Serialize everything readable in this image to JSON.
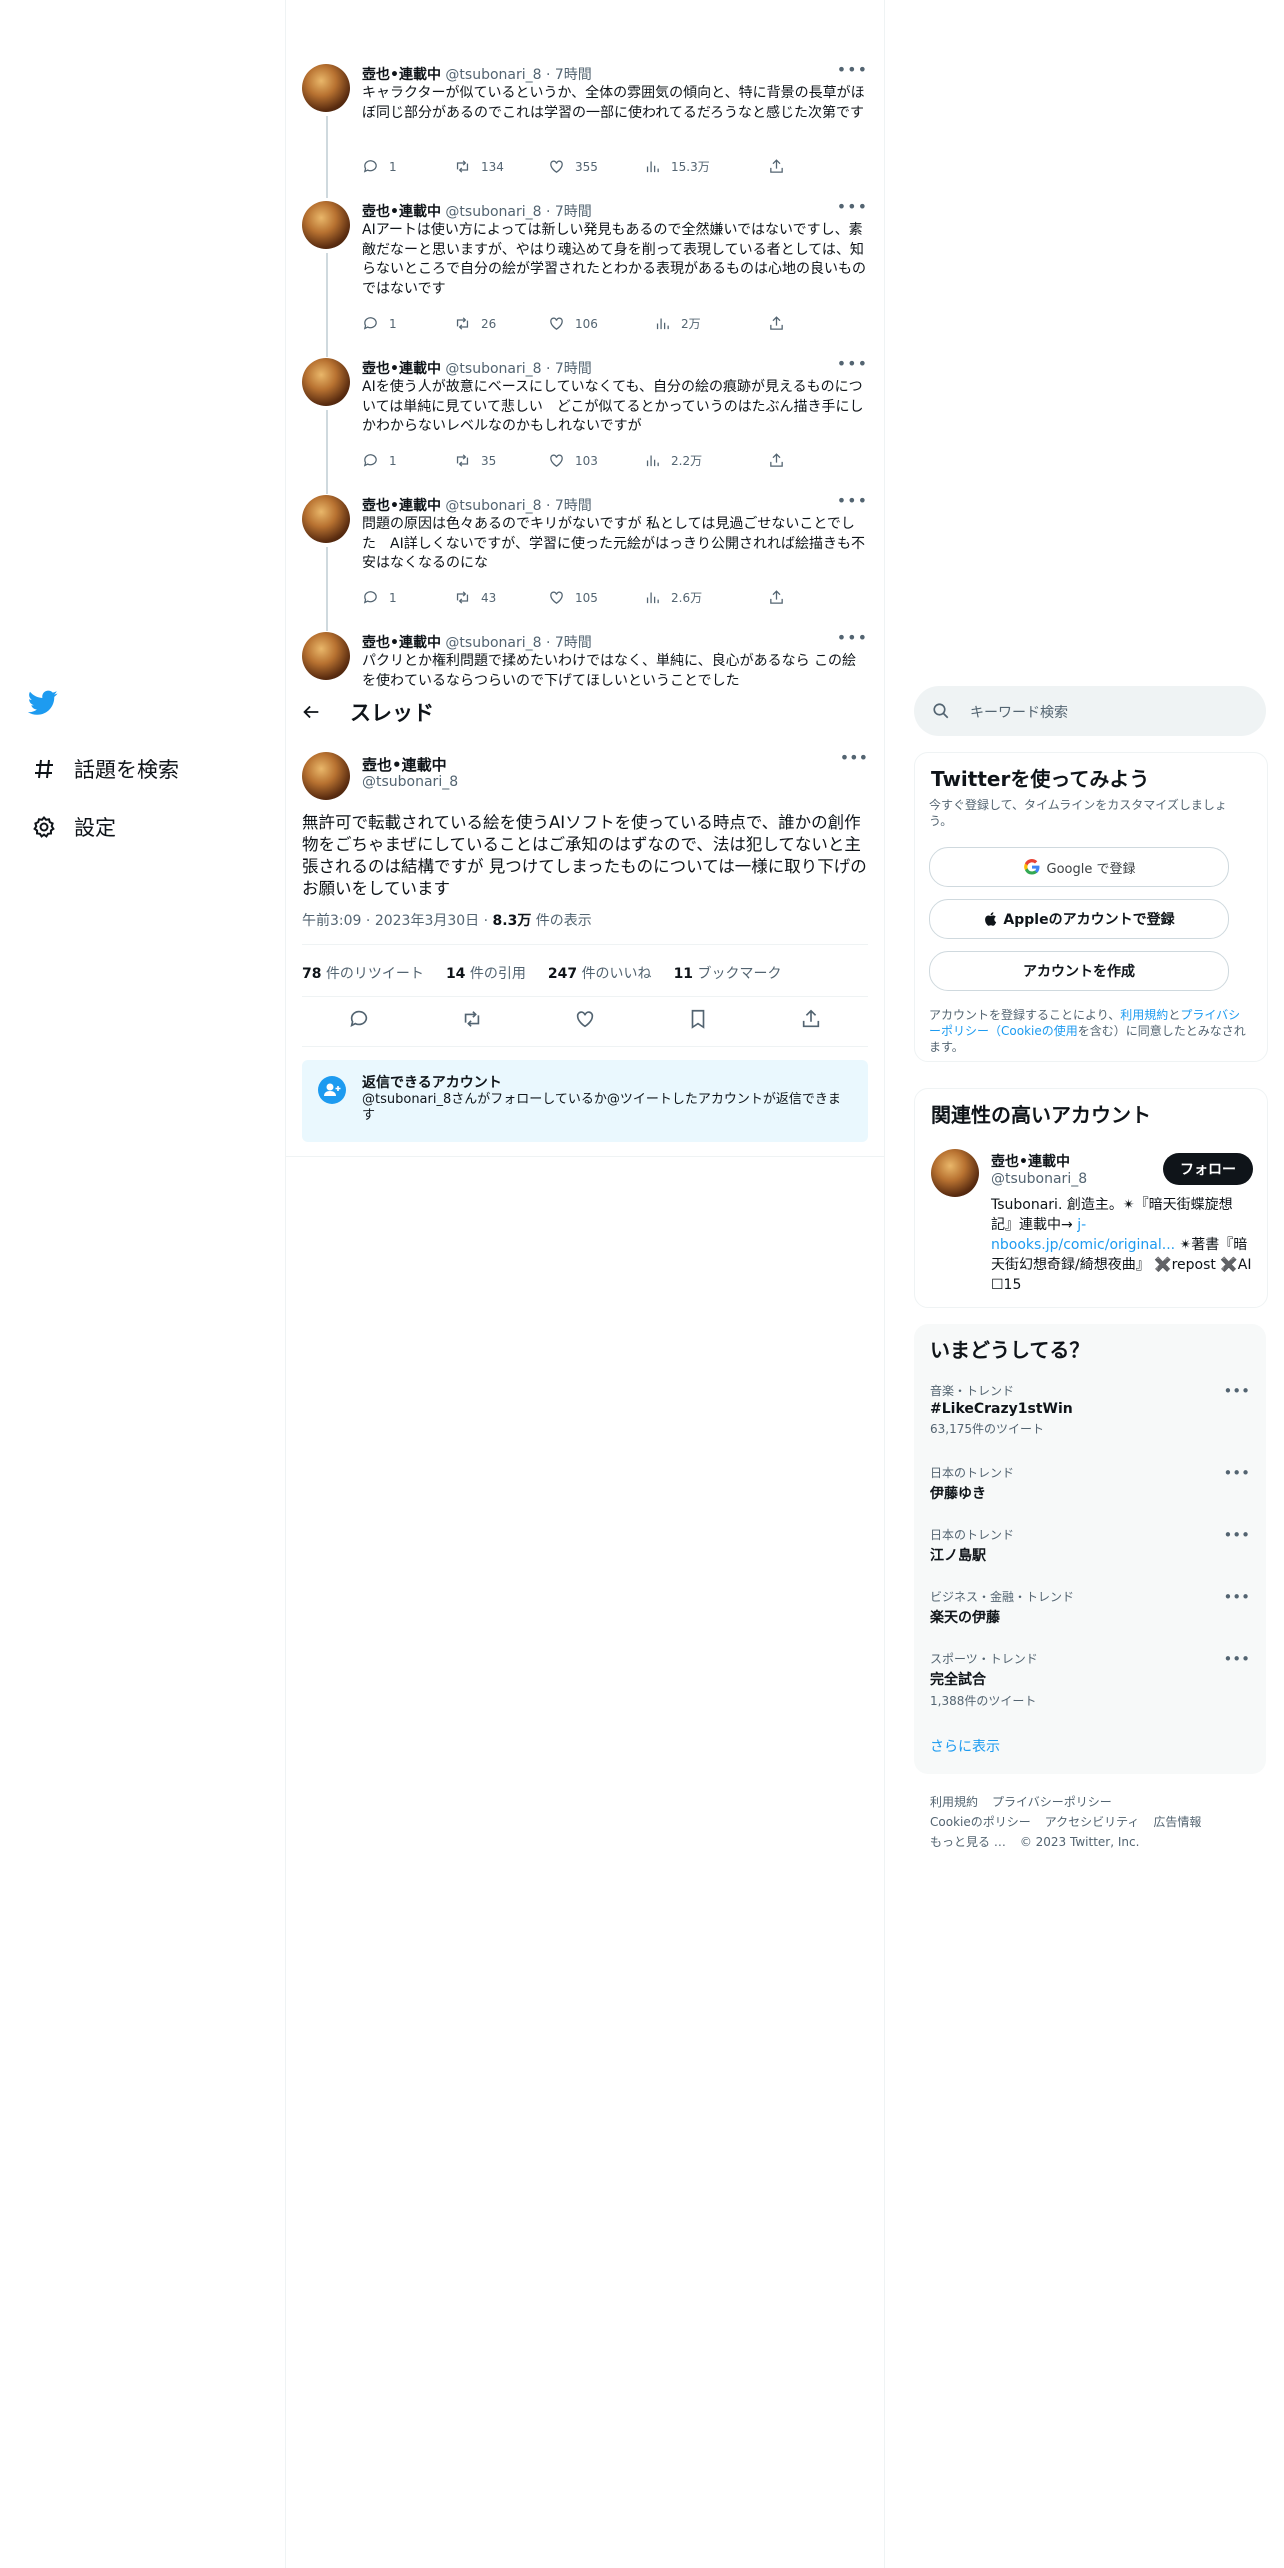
{
  "nav": {
    "items": [
      {
        "label": "話題を検索",
        "icon": "hashtag-icon"
      },
      {
        "label": "設定",
        "icon": "gear-icon"
      }
    ]
  },
  "thread": {
    "header_title": "スレッド",
    "tweets": [
      {
        "name": "壺也•連載中",
        "handle": "@tsubonari_8",
        "time": "7時間",
        "text": "キャラクターが似ているというか、全体の雰囲気の傾向と、特に背景の長草がほぼ同じ部分があるのでこれは学習の一部に使われてるだろうなと感じた次第です",
        "replies": "1",
        "retweets": "134",
        "likes": "355",
        "views": "15.3万"
      },
      {
        "name": "壺也•連載中",
        "handle": "@tsubonari_8",
        "time": "7時間",
        "text": "AIアートは使い方によっては新しい発見もあるので全然嫌いではないですし、素敵だなーと思いますが、やはり魂込めて身を削って表現している者としては、知らないところで自分の絵が学習されたとわかる表現があるものは心地の良いものではないです",
        "replies": "1",
        "retweets": "26",
        "likes": "106",
        "views": "2万"
      },
      {
        "name": "壺也•連載中",
        "handle": "@tsubonari_8",
        "time": "7時間",
        "text": "AIを使う人が故意にベースにしていなくても、自分の絵の痕跡が見えるものについては単純に見ていて悲しい　どこが似てるとかっていうのはたぶん描き手にしかわからないレベルなのかもしれないですが",
        "replies": "1",
        "retweets": "35",
        "likes": "103",
        "views": "2.2万"
      },
      {
        "name": "壺也•連載中",
        "handle": "@tsubonari_8",
        "time": "7時間",
        "text": "問題の原因は色々あるのでキリがないですが 私としては見過ごせないことでした　AI詳しくないですが、学習に使った元絵がはっきり公開されれば絵描きも不安はなくなるのにな",
        "replies": "1",
        "retweets": "43",
        "likes": "105",
        "views": "2.6万"
      },
      {
        "name": "壺也•連載中",
        "handle": "@tsubonari_8",
        "time": "7時間",
        "text": "パクリとか権利問題で揉めたいわけではなく、単純に、良心があるなら この絵を使わているならつらいので下げてほしいということでした",
        "replies": "",
        "retweets": "",
        "likes": "",
        "views": ""
      }
    ],
    "focal": {
      "name": "壺也•連載中",
      "handle": "@tsubonari_8",
      "text": "無許可で転載されている絵を使うAIソフトを使っている時点で、誰かの創作物をごちゃまぜにしていることはご承知のはずなので、法は犯してないと主張されるのは結構ですが 見つけてしまったものについては一様に取り下げのお願いをしています",
      "time": "午前3:09",
      "date": "2023年3月30日",
      "views_num": "8.3万",
      "views_label": "件の表示",
      "retweets_num": "78",
      "retweets_label": "件のリツイート",
      "quotes_num": "14",
      "quotes_label": "件の引用",
      "likes_num": "247",
      "likes_label": "件のいいね",
      "bookmarks_num": "11",
      "bookmarks_label": "ブックマーク"
    },
    "reply_notice": {
      "title": "返信できるアカウント",
      "text": "@tsubonari_8さんがフォローしているか@ツイートしたアカウントが返信できます"
    }
  },
  "sidebar": {
    "search_placeholder": "キーワード検索",
    "signup": {
      "title": "Twitterを使ってみよう",
      "subtitle": "今すぐ登録して、タイムラインをカスタマイズしましょう。",
      "google": "Google で登録",
      "apple": "Appleのアカウントで登録",
      "create": "アカウントを作成",
      "terms_prefix": "アカウントを登録することにより、",
      "terms_link": "利用規約",
      "terms_and": "と",
      "privacy_link": "プライバシーポリシー（Cookieの使用",
      "terms_suffix": "を含む）に同意したとみなされます。"
    },
    "related": {
      "title": "関連性の高いアカウント",
      "name": "壺也•連載中",
      "handle": "@tsubonari_8",
      "follow": "フォロー",
      "bio1": "Tsubonari. 創造主。✴︎『暗天街蝶旋想記』連載中→ ",
      "bio_link": "j-nbooks.jp/comic/original...",
      "bio2": " ✴︎著書『暗天街幻想奇録/綺想夜曲』 ✖️repost ✖️AI ☐15"
    },
    "trends": {
      "title": "いまどうしてる？",
      "items": [
        {
          "category": "音楽・トレンド",
          "name": "#LikeCrazy1stWin",
          "count": "63,175件のツイート"
        },
        {
          "category": "日本のトレンド",
          "name": "伊藤ゆき",
          "count": ""
        },
        {
          "category": "日本のトレンド",
          "name": "江ノ島駅",
          "count": ""
        },
        {
          "category": "ビジネス・金融・トレンド",
          "name": "楽天の伊藤",
          "count": ""
        },
        {
          "category": "スポーツ・トレンド",
          "name": "完全試合",
          "count": "1,388件のツイート"
        }
      ],
      "show_more": "さらに表示"
    },
    "footer": {
      "terms": "利用規約",
      "privacy": "プライバシーポリシー",
      "cookie": "Cookieのポリシー",
      "accessibility": "アクセシビリティ",
      "ads": "広告情報",
      "more": "もっと見る …",
      "copyright": "© 2023 Twitter, Inc."
    }
  },
  "colors": {
    "accent": "#1d9bf0",
    "text": "#0f1419",
    "muted": "#536471",
    "border": "#eff3f4"
  }
}
